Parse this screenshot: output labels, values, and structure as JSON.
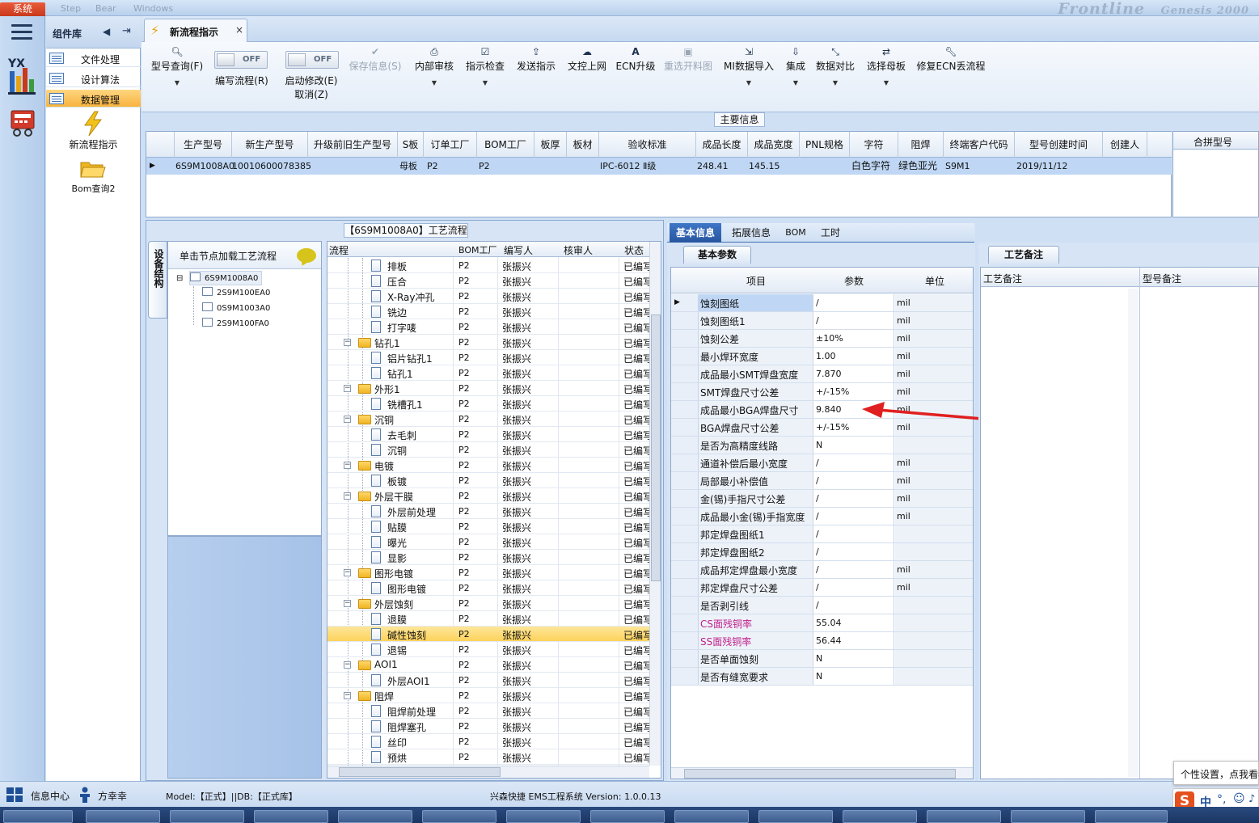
{
  "app": {
    "menu": {
      "system": "系统",
      "m1": "Step",
      "m2": "Bear",
      "m3": "Windows"
    },
    "brand_faint": "Frontline",
    "brand_faint2": "Genesis 2000",
    "left_badge": "YX"
  },
  "library": {
    "title": "组件库",
    "items": [
      {
        "label": "文件处理"
      },
      {
        "label": "设计算法"
      },
      {
        "label": "数据管理"
      }
    ],
    "sub_items": [
      {
        "label": "新流程指示"
      },
      {
        "label": "Bom查询2"
      }
    ]
  },
  "doc_tab": {
    "title": "新流程指示",
    "close": "×"
  },
  "ribbon": {
    "query_label": "型号查询(F)",
    "write_flow_label": "编写流程(R)",
    "enable_modify_label": "启动修改(E)",
    "cancel_label": "取消(Z)",
    "toggle_state": "OFF",
    "buttons": [
      {
        "label": "保存信息(S)",
        "icon": "check-icon"
      },
      {
        "label": "内部审核",
        "icon": "print-icon"
      },
      {
        "label": "指示检查",
        "icon": "checkbox-icon"
      },
      {
        "label": "发送指示",
        "icon": "upload-icon"
      },
      {
        "label": "文控上网",
        "icon": "cloud-upload-icon"
      },
      {
        "label": "ECN升级",
        "icon": "font-icon"
      },
      {
        "label": "重选开料图",
        "icon": "image-icon"
      },
      {
        "label": "MI数据导入",
        "icon": "import-icon"
      },
      {
        "label": "集成",
        "icon": "download-icon"
      },
      {
        "label": "数据对比",
        "icon": "compress-icon"
      },
      {
        "label": "选择母板",
        "icon": "shuffle-icon"
      },
      {
        "label": "修复ECN丢流程",
        "icon": "wrench-icon"
      }
    ]
  },
  "main_info": {
    "legend": "主要信息",
    "columns": [
      "生产型号",
      "新生产型号",
      "升级前旧生产型号",
      "S板",
      "订单工厂",
      "BOM工厂",
      "板厚",
      "板材",
      "验收标准",
      "成品长度",
      "成品宽度",
      "PNL规格",
      "字符",
      "阻焊",
      "终端客户代码",
      "型号创建时间",
      "创建人"
    ],
    "row": {
      "col1": "6S9M1008A0",
      "col2": "10010600078385",
      "col3": "",
      "col4": "母板",
      "col5": "P2",
      "col6": "P2",
      "col7": "",
      "col8": "",
      "col9": "IPC-6012 Ⅱ级",
      "col10": "248.41",
      "col11": "145.15",
      "col12": "",
      "col13": "白色字符",
      "col14": "绿色亚光",
      "col15": "S9M1",
      "col16": "2019/11/12",
      "col17": ""
    },
    "merge_column": "合拼型号"
  },
  "process": {
    "legend": "【6S9M1008A0】工艺流程",
    "side_tab": "设备结构",
    "hint": "单击节点加载工艺流程",
    "tree": {
      "root": "6S9M1008A0",
      "children": [
        "2S9M100EA0",
        "0S9M1003A0",
        "2S9M100FA0"
      ]
    },
    "columns": {
      "flow": "流程",
      "bom_factory": "BOM工厂",
      "writer": "编写人",
      "reviewer": "核审人",
      "status": "状态"
    },
    "rows": [
      {
        "name": "排板",
        "bom": "P2",
        "writer": "张振兴",
        "status": "已编写"
      },
      {
        "name": "压合",
        "bom": "P2",
        "writer": "张振兴",
        "status": "已编写"
      },
      {
        "name": "X-Ray冲孔",
        "bom": "P2",
        "writer": "张振兴",
        "status": "已编写"
      },
      {
        "name": "铣边",
        "bom": "P2",
        "writer": "张振兴",
        "status": "已编写"
      },
      {
        "name": "打字唛",
        "bom": "P2",
        "writer": "张振兴",
        "status": "已编写"
      },
      {
        "name": "钻孔1",
        "bom": "P2",
        "writer": "张振兴",
        "status": "已编写"
      },
      {
        "name": "铝片钻孔1",
        "bom": "P2",
        "writer": "张振兴",
        "status": "已编写"
      },
      {
        "name": "钻孔1",
        "bom": "P2",
        "writer": "张振兴",
        "status": "已编写"
      },
      {
        "name": "外形1",
        "bom": "P2",
        "writer": "张振兴",
        "status": "已编写"
      },
      {
        "name": "铣槽孔1",
        "bom": "P2",
        "writer": "张振兴",
        "status": "已编写"
      },
      {
        "name": "沉铜",
        "bom": "P2",
        "writer": "张振兴",
        "status": "已编写"
      },
      {
        "name": "去毛刺",
        "bom": "P2",
        "writer": "张振兴",
        "status": "已编写"
      },
      {
        "name": "沉铜",
        "bom": "P2",
        "writer": "张振兴",
        "status": "已编写"
      },
      {
        "name": "电镀",
        "bom": "P2",
        "writer": "张振兴",
        "status": "已编写"
      },
      {
        "name": "板镀",
        "bom": "P2",
        "writer": "张振兴",
        "status": "已编写"
      },
      {
        "name": "外层干膜",
        "bom": "P2",
        "writer": "张振兴",
        "status": "已编写"
      },
      {
        "name": "外层前处理",
        "bom": "P2",
        "writer": "张振兴",
        "status": "已编写"
      },
      {
        "name": "贴膜",
        "bom": "P2",
        "writer": "张振兴",
        "status": "已编写"
      },
      {
        "name": "曝光",
        "bom": "P2",
        "writer": "张振兴",
        "status": "已编写"
      },
      {
        "name": "显影",
        "bom": "P2",
        "writer": "张振兴",
        "status": "已编写"
      },
      {
        "name": "图形电镀",
        "bom": "P2",
        "writer": "张振兴",
        "status": "已编写"
      },
      {
        "name": "图形电镀",
        "bom": "P2",
        "writer": "张振兴",
        "status": "已编写"
      },
      {
        "name": "外层蚀刻",
        "bom": "P2",
        "writer": "张振兴",
        "status": "已编写"
      },
      {
        "name": "退膜",
        "bom": "P2",
        "writer": "张振兴",
        "status": "已编写"
      },
      {
        "name": "碱性蚀刻",
        "bom": "P2",
        "writer": "张振兴",
        "status": "已编写"
      },
      {
        "name": "退锡",
        "bom": "P2",
        "writer": "张振兴",
        "status": "已编写"
      },
      {
        "name": "AOI1",
        "bom": "P2",
        "writer": "张振兴",
        "status": "已编写"
      },
      {
        "name": "外层AOI1",
        "bom": "P2",
        "writer": "张振兴",
        "status": "已编写"
      },
      {
        "name": "阻焊",
        "bom": "P2",
        "writer": "张振兴",
        "status": "已编写"
      },
      {
        "name": "阻焊前处理",
        "bom": "P2",
        "writer": "张振兴",
        "status": "已编写"
      },
      {
        "name": "阻焊塞孔",
        "bom": "P2",
        "writer": "张振兴",
        "status": "已编写"
      },
      {
        "name": "丝印",
        "bom": "P2",
        "writer": "张振兴",
        "status": "已编写"
      },
      {
        "name": "预烘",
        "bom": "P2",
        "writer": "张振兴",
        "status": "已编写"
      }
    ]
  },
  "info_panel": {
    "tabs": [
      "基本信息",
      "拓展信息",
      "BOM",
      "工时"
    ],
    "subtab": "基本参数",
    "columns": {
      "item": "项目",
      "param": "参数",
      "unit": "单位"
    },
    "rows": [
      {
        "item": "蚀刻图纸",
        "param": "/",
        "unit": "mil"
      },
      {
        "item": "蚀刻图纸1",
        "param": "/",
        "unit": "mil"
      },
      {
        "item": "蚀刻公差",
        "param": "±10%",
        "unit": "mil"
      },
      {
        "item": "最小焊环宽度",
        "param": "1.00",
        "unit": "mil"
      },
      {
        "item": "成品最小SMT焊盘宽度",
        "param": "7.870",
        "unit": "mil"
      },
      {
        "item": "SMT焊盘尺寸公差",
        "param": "+/-15%",
        "unit": "mil"
      },
      {
        "item": "成品最小BGA焊盘尺寸",
        "param": "9.840",
        "unit": "mil"
      },
      {
        "item": "BGA焊盘尺寸公差",
        "param": "+/-15%",
        "unit": "mil"
      },
      {
        "item": "是否为高精度线路",
        "param": "N",
        "unit": ""
      },
      {
        "item": "通道补偿后最小宽度",
        "param": "/",
        "unit": "mil"
      },
      {
        "item": "局部最小补偿值",
        "param": "/",
        "unit": "mil"
      },
      {
        "item": "金(锡)手指尺寸公差",
        "param": "/",
        "unit": "mil"
      },
      {
        "item": "成品最小金(锡)手指宽度",
        "param": "/",
        "unit": "mil"
      },
      {
        "item": "邦定焊盘图纸1",
        "param": "/",
        "unit": ""
      },
      {
        "item": "邦定焊盘图纸2",
        "param": "/",
        "unit": ""
      },
      {
        "item": "成品邦定焊盘最小宽度",
        "param": "/",
        "unit": "mil"
      },
      {
        "item": "邦定焊盘尺寸公差",
        "param": "/",
        "unit": "mil"
      },
      {
        "item": "是否剥引线",
        "param": "/",
        "unit": ""
      },
      {
        "item": "CS面残铜率",
        "param": "55.04",
        "unit": ""
      },
      {
        "item": "SS面残铜率",
        "param": "56.44",
        "unit": ""
      },
      {
        "item": "是否单面蚀刻",
        "param": "N",
        "unit": ""
      },
      {
        "item": "是否有缝宽要求",
        "param": "N",
        "unit": ""
      }
    ]
  },
  "notes_panel": {
    "tab": "工艺备注",
    "col1": "工艺备注",
    "col2": "型号备注"
  },
  "status": {
    "info_center": "信息中心",
    "user": "方幸幸",
    "model_db": "Model:【正式】||DB:【正式库】",
    "system_version": "兴森快捷 EMS工程系统 Version: 1.0.0.13"
  },
  "tooltip": "个性设置，点我看看",
  "ime": {
    "logo": "S",
    "lang": "中"
  },
  "colors": {
    "accent": "#2856a0",
    "selected_row": "#bfd7f4",
    "highlight": "#fcd25b",
    "annotation_arrow": "#e02020"
  }
}
